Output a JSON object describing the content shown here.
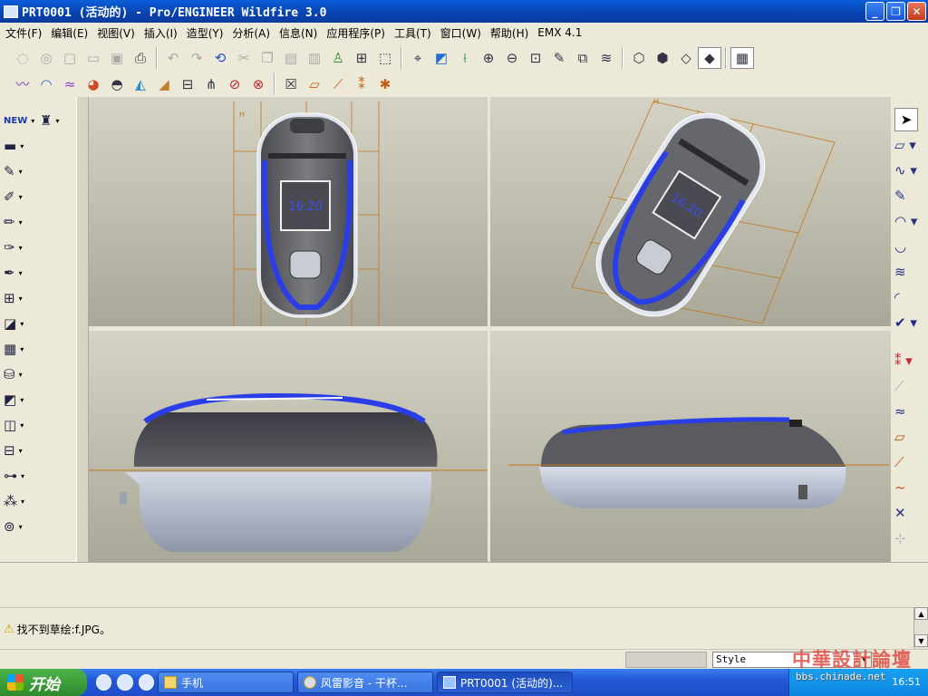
{
  "window": {
    "title": "PRT0001 (活动的) - Pro/ENGINEER Wildfire 3.0",
    "controls": {
      "minimize": "_",
      "maximize": "❐",
      "close": "✕"
    }
  },
  "menu": {
    "items": [
      {
        "label": "文件(F)"
      },
      {
        "label": "编辑(E)"
      },
      {
        "label": "视图(V)"
      },
      {
        "label": "插入(I)"
      },
      {
        "label": "造型(Y)"
      },
      {
        "label": "分析(A)"
      },
      {
        "label": "信息(N)"
      },
      {
        "label": "应用程序(P)"
      },
      {
        "label": "工具(T)"
      },
      {
        "label": "窗口(W)"
      },
      {
        "label": "帮助(H)"
      },
      {
        "label": "EMX 4.1"
      }
    ]
  },
  "toolbar": {
    "row1": [
      {
        "icon": "new-file-icon"
      },
      {
        "icon": "open-file-icon"
      },
      {
        "icon": "blank-icon"
      },
      {
        "icon": "open-folder-icon"
      },
      {
        "icon": "save-icon"
      },
      {
        "icon": "print-icon"
      },
      {
        "icon": "undo-icon"
      },
      {
        "icon": "redo-icon"
      },
      {
        "icon": "regenerate-icon"
      },
      {
        "icon": "cut-icon"
      },
      {
        "icon": "copy-icon"
      },
      {
        "icon": "paste-icon"
      },
      {
        "icon": "paste-special-icon"
      },
      {
        "icon": "model-player-icon"
      },
      {
        "icon": "find-icon"
      },
      {
        "icon": "selection-box-icon"
      },
      {
        "icon": "spin-center-icon"
      },
      {
        "icon": "orient-icon"
      },
      {
        "icon": "axis-icon"
      },
      {
        "icon": "zoom-in-icon"
      },
      {
        "icon": "zoom-out-icon"
      },
      {
        "icon": "refit-icon"
      },
      {
        "icon": "repaint-icon"
      },
      {
        "icon": "view-manager-icon"
      },
      {
        "icon": "layers-icon"
      },
      {
        "icon": "wireframe-icon"
      },
      {
        "icon": "hidden-line-icon"
      },
      {
        "icon": "no-hidden-icon"
      },
      {
        "icon": "shading-icon"
      },
      {
        "icon": "grid-view-icon"
      }
    ],
    "row2": [
      {
        "icon": "curve-analysis-icon"
      },
      {
        "icon": "surface-analysis-icon"
      },
      {
        "icon": "reflection-icon"
      },
      {
        "icon": "gaussian-icon"
      },
      {
        "icon": "section-icon"
      },
      {
        "icon": "draft-icon"
      },
      {
        "icon": "slope-icon"
      },
      {
        "icon": "deviation-icon"
      },
      {
        "icon": "dihedral-icon"
      },
      {
        "icon": "curvature-icon"
      },
      {
        "icon": "clear-analysis-icon"
      },
      {
        "icon": "close-box-icon"
      },
      {
        "icon": "plane-icon"
      },
      {
        "icon": "axis-display-icon"
      },
      {
        "icon": "point-display-icon"
      },
      {
        "icon": "csys-display-icon"
      }
    ]
  },
  "left_tools": [
    {
      "icon": "new-feature-icon",
      "label": "NEW"
    },
    {
      "icon": "feature-group-icon"
    },
    {
      "icon": "extrude-tool-icon"
    },
    {
      "icon": "datum-plane-icon"
    },
    {
      "icon": "sweep-icon"
    },
    {
      "icon": "sketch-icon"
    },
    {
      "icon": "edit-feature-icon"
    },
    {
      "icon": "round-icon"
    },
    {
      "icon": "shell-icon"
    },
    {
      "icon": "pattern-icon"
    },
    {
      "icon": "table-icon"
    },
    {
      "icon": "db-icon"
    },
    {
      "icon": "offset-icon"
    },
    {
      "icon": "trim-icon"
    },
    {
      "icon": "merge-icon"
    },
    {
      "icon": "mirror-icon"
    },
    {
      "icon": "point-pattern-icon"
    },
    {
      "icon": "chain-icon"
    }
  ],
  "right_tools": [
    {
      "icon": "select-arrow-icon"
    },
    {
      "icon": "plane-tool-icon"
    },
    {
      "icon": "curve-tool-icon"
    },
    {
      "icon": "edit-curve-icon"
    },
    {
      "icon": "boundary-surface-icon"
    },
    {
      "icon": "surface-edit-icon"
    },
    {
      "icon": "connect-icon"
    },
    {
      "icon": "trim-surface-icon"
    },
    {
      "icon": "done-check-icon"
    },
    {
      "icon": "point-cross-icon"
    },
    {
      "icon": "offset-curve-icon"
    },
    {
      "icon": "project-curve-icon"
    },
    {
      "icon": "sketch-plane-icon"
    },
    {
      "icon": "line-icon"
    },
    {
      "icon": "spline-icon"
    },
    {
      "icon": "intersect-icon"
    },
    {
      "icon": "xyz-icon"
    }
  ],
  "viewports": {
    "top_left": {
      "clock": "16:20",
      "datum_label": "H"
    },
    "top_right": {
      "clock": "16:20",
      "datum_label": "H"
    },
    "bottom_left": {},
    "bottom_right": {}
  },
  "message": {
    "icon": "warning-icon",
    "text": "找不到草绘:f.JPG。"
  },
  "status": {
    "style_value": "Style"
  },
  "taskbar": {
    "start_label": "开始",
    "tasks": [
      {
        "label": "手机",
        "icon": "folder-icon"
      },
      {
        "label": "风雷影音 - 干杯...",
        "icon": "media-player-icon"
      },
      {
        "label": "PRT0001 (活动的)...",
        "icon": "proe-icon"
      }
    ],
    "clock": "16:51"
  },
  "watermark": {
    "line1": "中華設計論壇",
    "line2": "bbs.chinade.net"
  },
  "colors": {
    "titlebar": "#0a5fd8",
    "accent_blue": "#2a3ee8",
    "phone_gray": "#6b6c70",
    "datum_orange": "#c07820"
  }
}
